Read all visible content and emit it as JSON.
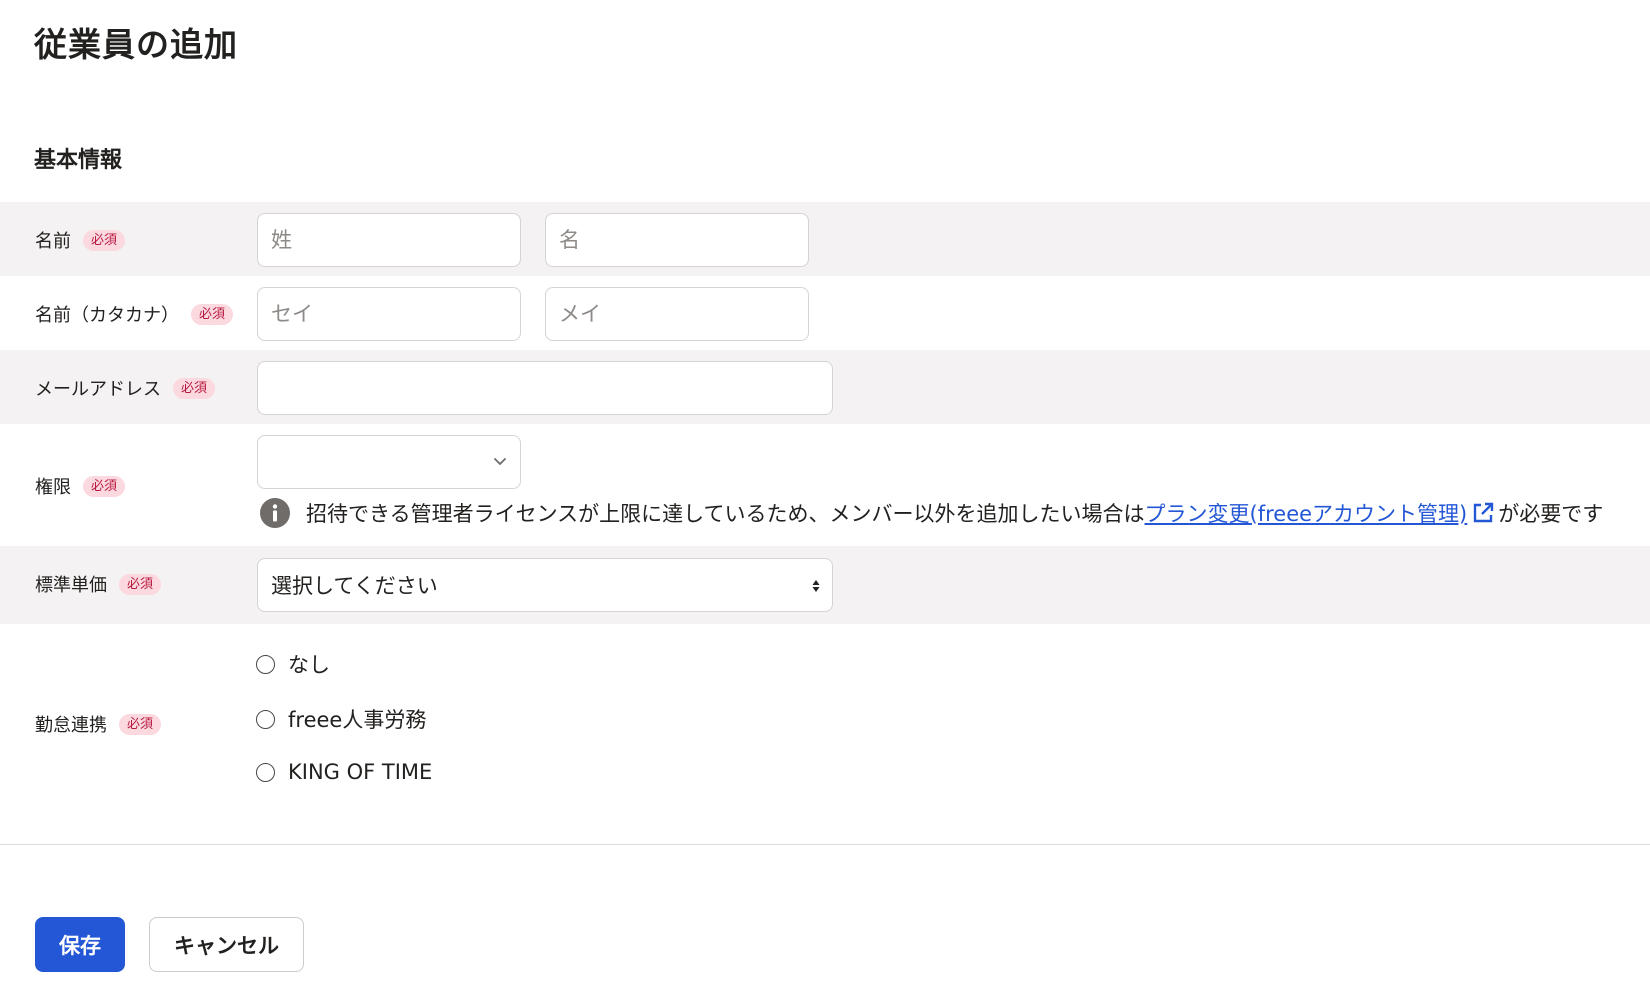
{
  "page": {
    "title": "従業員の追加"
  },
  "section": {
    "title": "基本情報"
  },
  "required_badge": "必須",
  "fields": {
    "name": {
      "label": "名前",
      "last_placeholder": "姓",
      "first_placeholder": "名"
    },
    "kana": {
      "label": "名前（カタカナ）",
      "last_placeholder": "セイ",
      "first_placeholder": "メイ"
    },
    "email": {
      "label": "メールアドレス",
      "value": ""
    },
    "role": {
      "label": "権限",
      "selected": "",
      "notice_text": "招待できる管理者ライセンスが上限に達しているため、メンバー以外を追加したい場合は",
      "notice_link": "プラン変更(freeeアカウント管理)",
      "notice_suffix": "が必要です"
    },
    "unit_price": {
      "label": "標準単価",
      "selected": "選択してください"
    },
    "attendance": {
      "label": "勤怠連携",
      "options": [
        "なし",
        "freee人事労務",
        "KING OF TIME"
      ]
    }
  },
  "actions": {
    "save_label": "保存",
    "cancel_label": "キャンセル"
  },
  "colors": {
    "primary": "#2357d6",
    "badge_bg": "#fbd9df",
    "badge_text": "#b8193f",
    "row_shade": "#f4f2f2",
    "link": "#2357d6"
  },
  "icons": {
    "role_select": "chevron-down-icon",
    "unit_price_select": "sort-updown-icon",
    "notice": "info-icon",
    "link": "external-link-icon"
  }
}
